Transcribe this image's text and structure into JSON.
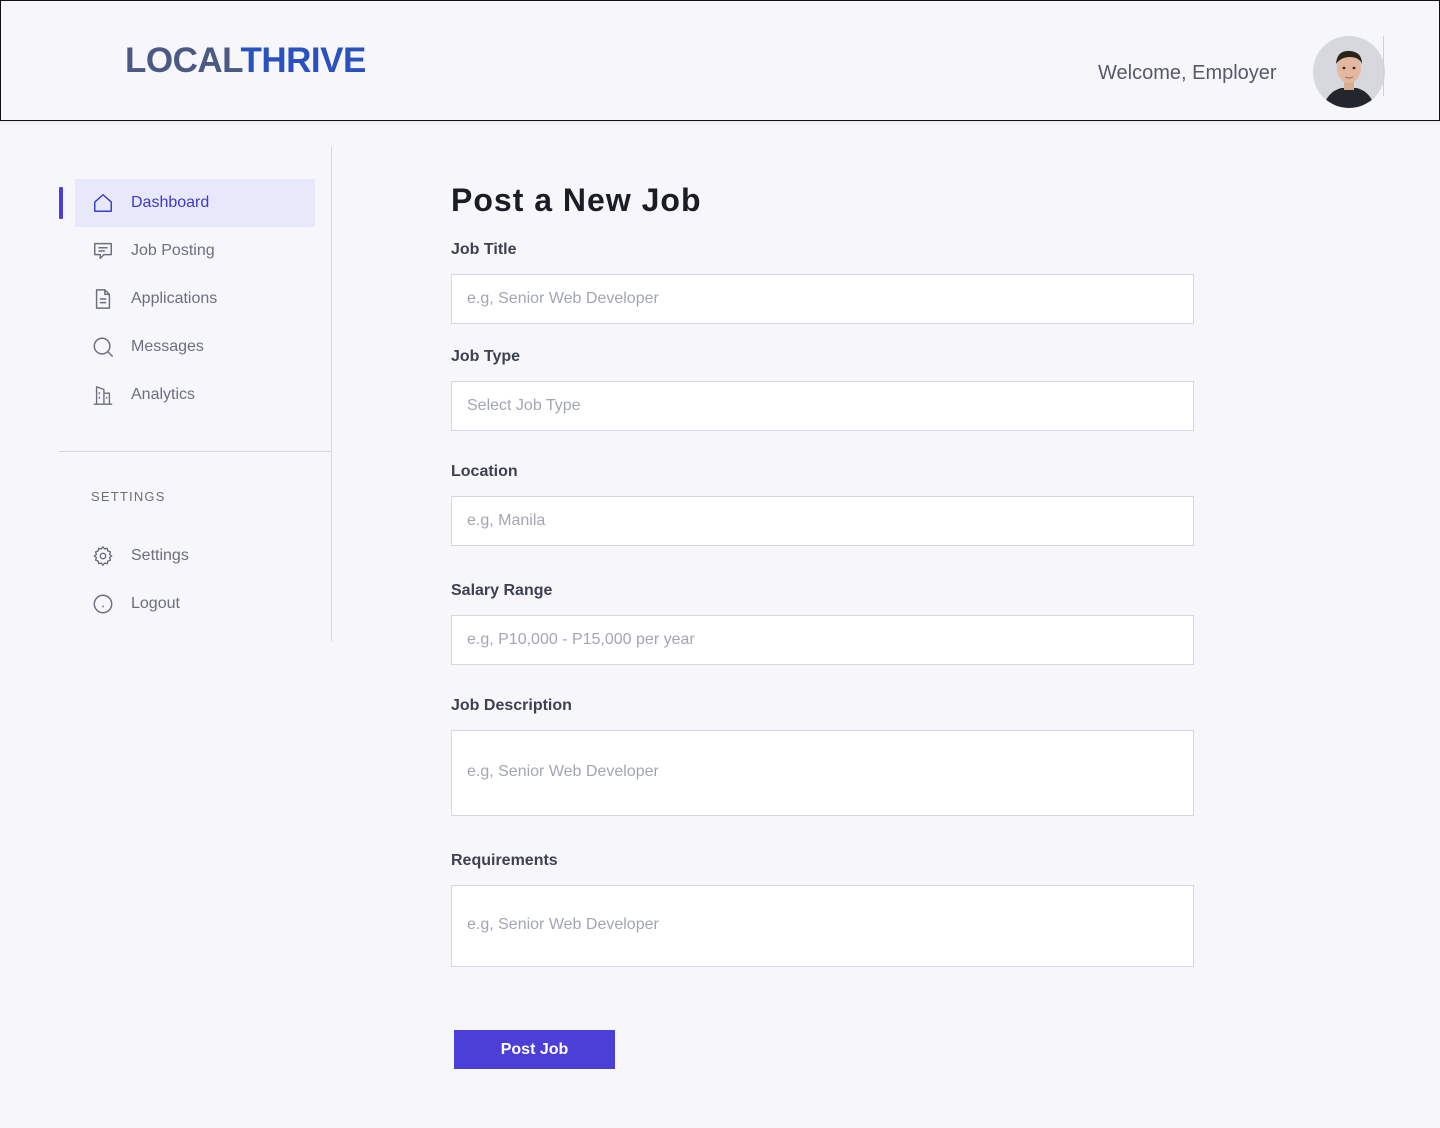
{
  "header": {
    "logo_part1": "LOCAL",
    "logo_part2": "THRIVE",
    "welcome_text": "Welcome, Employer",
    "avatar_icon": "user-avatar"
  },
  "sidebar": {
    "items": [
      {
        "label": "Dashboard",
        "icon": "home-icon",
        "active": true
      },
      {
        "label": "Job Posting",
        "icon": "message-square-icon",
        "active": false
      },
      {
        "label": "Applications",
        "icon": "document-icon",
        "active": false
      },
      {
        "label": "Messages",
        "icon": "search-icon",
        "active": false
      },
      {
        "label": "Analytics",
        "icon": "building-icon",
        "active": false
      }
    ],
    "settings_heading": "SETTINGS",
    "settings_items": [
      {
        "label": "Settings",
        "icon": "gear-icon"
      },
      {
        "label": "Logout",
        "icon": "circle-icon"
      }
    ]
  },
  "form": {
    "title": "Post a New Job",
    "job_title": {
      "label": "Job Title",
      "placeholder": "e.g, Senior Web Developer",
      "value": ""
    },
    "job_type": {
      "label": "Job Type",
      "placeholder": "Select Job Type",
      "value": ""
    },
    "location": {
      "label": "Location",
      "placeholder": "e.g, Manila",
      "value": ""
    },
    "salary_range": {
      "label": "Salary Range",
      "placeholder": "e.g, P10,000 - P15,000 per year",
      "value": ""
    },
    "job_description": {
      "label": "Job Description",
      "placeholder": "e.g, Senior Web Developer",
      "value": ""
    },
    "requirements": {
      "label": "Requirements",
      "placeholder": "e.g, Senior Web Developer",
      "value": ""
    },
    "submit_label": "Post Job"
  },
  "colors": {
    "accent": "#4b3fd8",
    "logo_dark": "#4a5a85",
    "logo_blue": "#2a52be",
    "active_bg": "#e8e8fb",
    "page_bg": "#f7f7fb"
  }
}
